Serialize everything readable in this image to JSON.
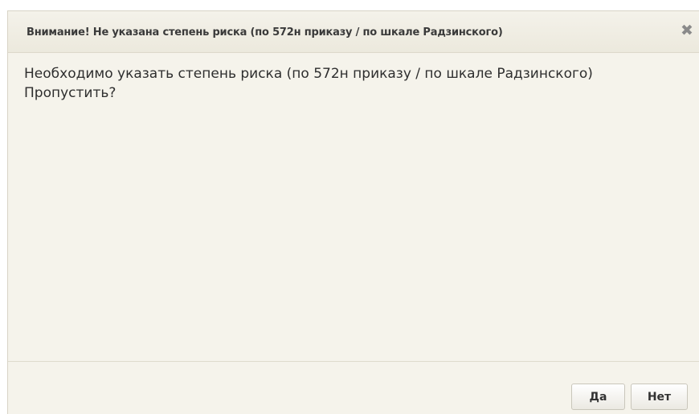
{
  "dialog": {
    "title": "Внимание! Не указана степень риска (по 572н приказу / по шкале Радзинского)",
    "close_glyph": "✖",
    "message_line1": "Необходимо указать степень риска (по 572н приказу / по шкале Радзинского)",
    "message_line2": "Пропустить?",
    "yes_label": "Да",
    "no_label": "Нет"
  },
  "colors": {
    "dialog_background": "#f5f3eb",
    "title_text": "#3a3a3a",
    "close_icon": "#8a8a8a"
  },
  "icons": {
    "close": "close-icon"
  }
}
